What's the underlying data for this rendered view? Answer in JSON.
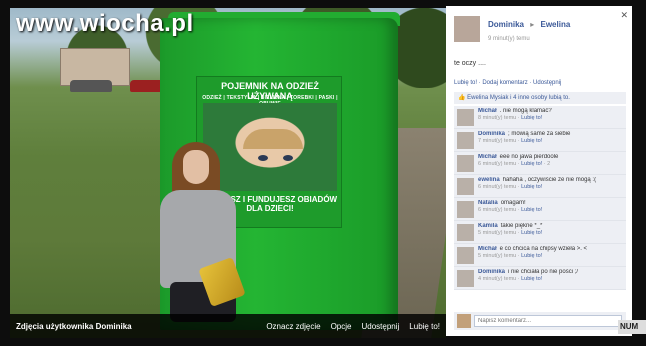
{
  "watermark": "www.wiocha.pl",
  "poster": {
    "title": "POJEMNIK NA ODZIEŻ UŻYWANĄ",
    "subtitle": "ODZIEŻ | TEKSTYLIA | BIELIZNA | TOREBKI | PASKI | OBUWIE",
    "footer": "UGUJESZ I FUNDUJESZ OBIADÓW DLA DZIECI!"
  },
  "photo_bar": {
    "owner": "Zdjęcia użytkownika Dominika",
    "actions": [
      "Oznacz zdjęcie",
      "Opcje",
      "Udostępnij",
      "Lubię to!"
    ]
  },
  "post": {
    "author": "Dominika",
    "recipient": "Ewelina",
    "time": "9 minut(y) temu",
    "text": "te oczy ....",
    "actions": "Lubię to! · Dodaj komentarz · Udostępnij",
    "likes": "Ewelina Mysiak i 4 inne osoby lubią to."
  },
  "comments": [
    {
      "name": "Michał",
      "text": ". nie mogą klamać?",
      "time": "8 minut(y) temu",
      "like": "Lubię to!",
      "extra": ""
    },
    {
      "name": "Dominika",
      "text": "; mówią same za siebie",
      "time": "7 minut(y) temu",
      "like": "Lubię to!",
      "extra": ""
    },
    {
      "name": "Michał",
      "text": "eee no jawa pierdoole",
      "time": "6 minut(y) temu",
      "like": "Lubię to!",
      "extra": "2"
    },
    {
      "name": "ewelina",
      "text": "hahaha , oczywiście że nie mogą :(",
      "time": "6 minut(y) temu",
      "like": "Lubię to!",
      "extra": ""
    },
    {
      "name": "Natalia",
      "text": "omagam!",
      "time": "6 minut(y) temu",
      "like": "Lubię to!",
      "extra": ""
    },
    {
      "name": "Kamila",
      "text": "takie piękne *_*",
      "time": "5 minut(y) temu",
      "like": "Lubię to!",
      "extra": ""
    },
    {
      "name": "Michał",
      "text": "e co chcica na chipsy wzieła >. <",
      "time": "5 minut(y) temu",
      "like": "Lubię to!",
      "extra": ""
    },
    {
      "name": "Dominika",
      "text": "i nie chciała po nie pości ;/",
      "time": "4 minut(y) temu",
      "like": "Lubię to!",
      "extra": ""
    }
  ],
  "compose": {
    "placeholder": "Napisz komentarz..."
  },
  "side_badge": "NUM",
  "close_glyph": "✕"
}
